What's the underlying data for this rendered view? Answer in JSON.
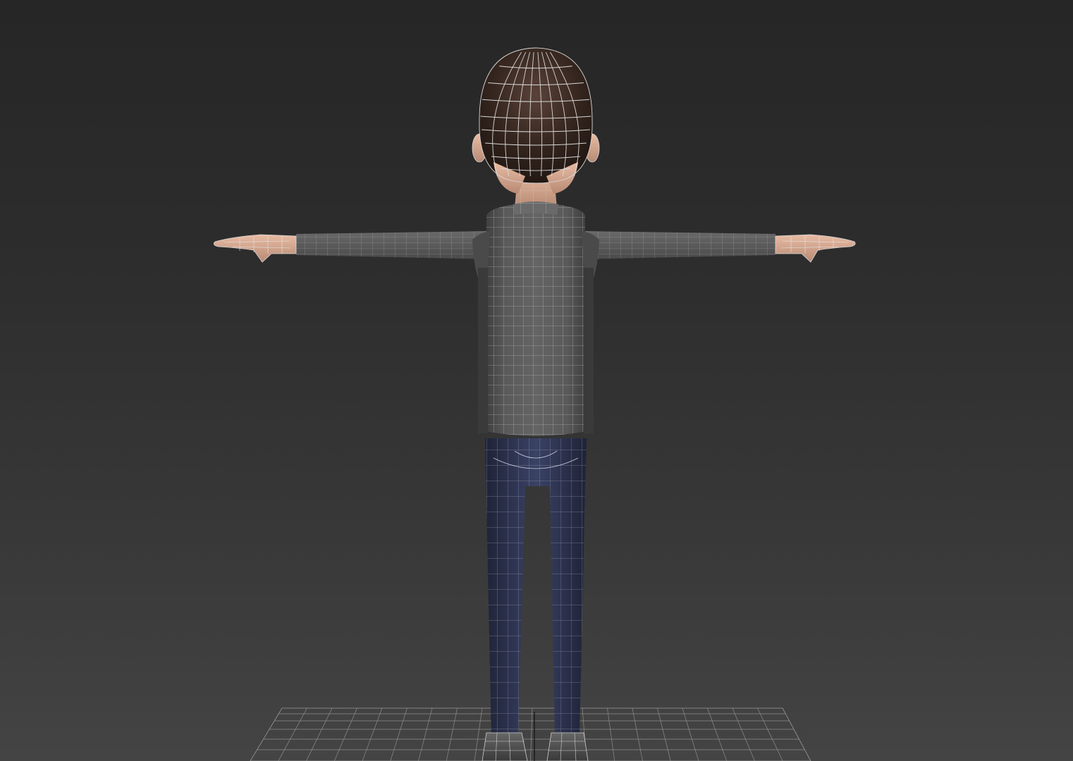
{
  "viewport": {
    "view": "perspective-back",
    "shading": "smooth-with-wireframe-edges"
  },
  "colors": {
    "background_top": "#262626",
    "background_bottom": "#444444",
    "wireframe": "#d8d8d8",
    "hair": "#3a2a22",
    "skin": "#d8a890",
    "shirt": "#5c5c5c",
    "pants": "#2e3552",
    "shoes": "#555555",
    "grid": "#9a9a9a"
  },
  "model": {
    "name": "cartoon-boy-character",
    "pose": "T-pose"
  },
  "icons": {
    "pivot": "transform-pivot-icon"
  }
}
